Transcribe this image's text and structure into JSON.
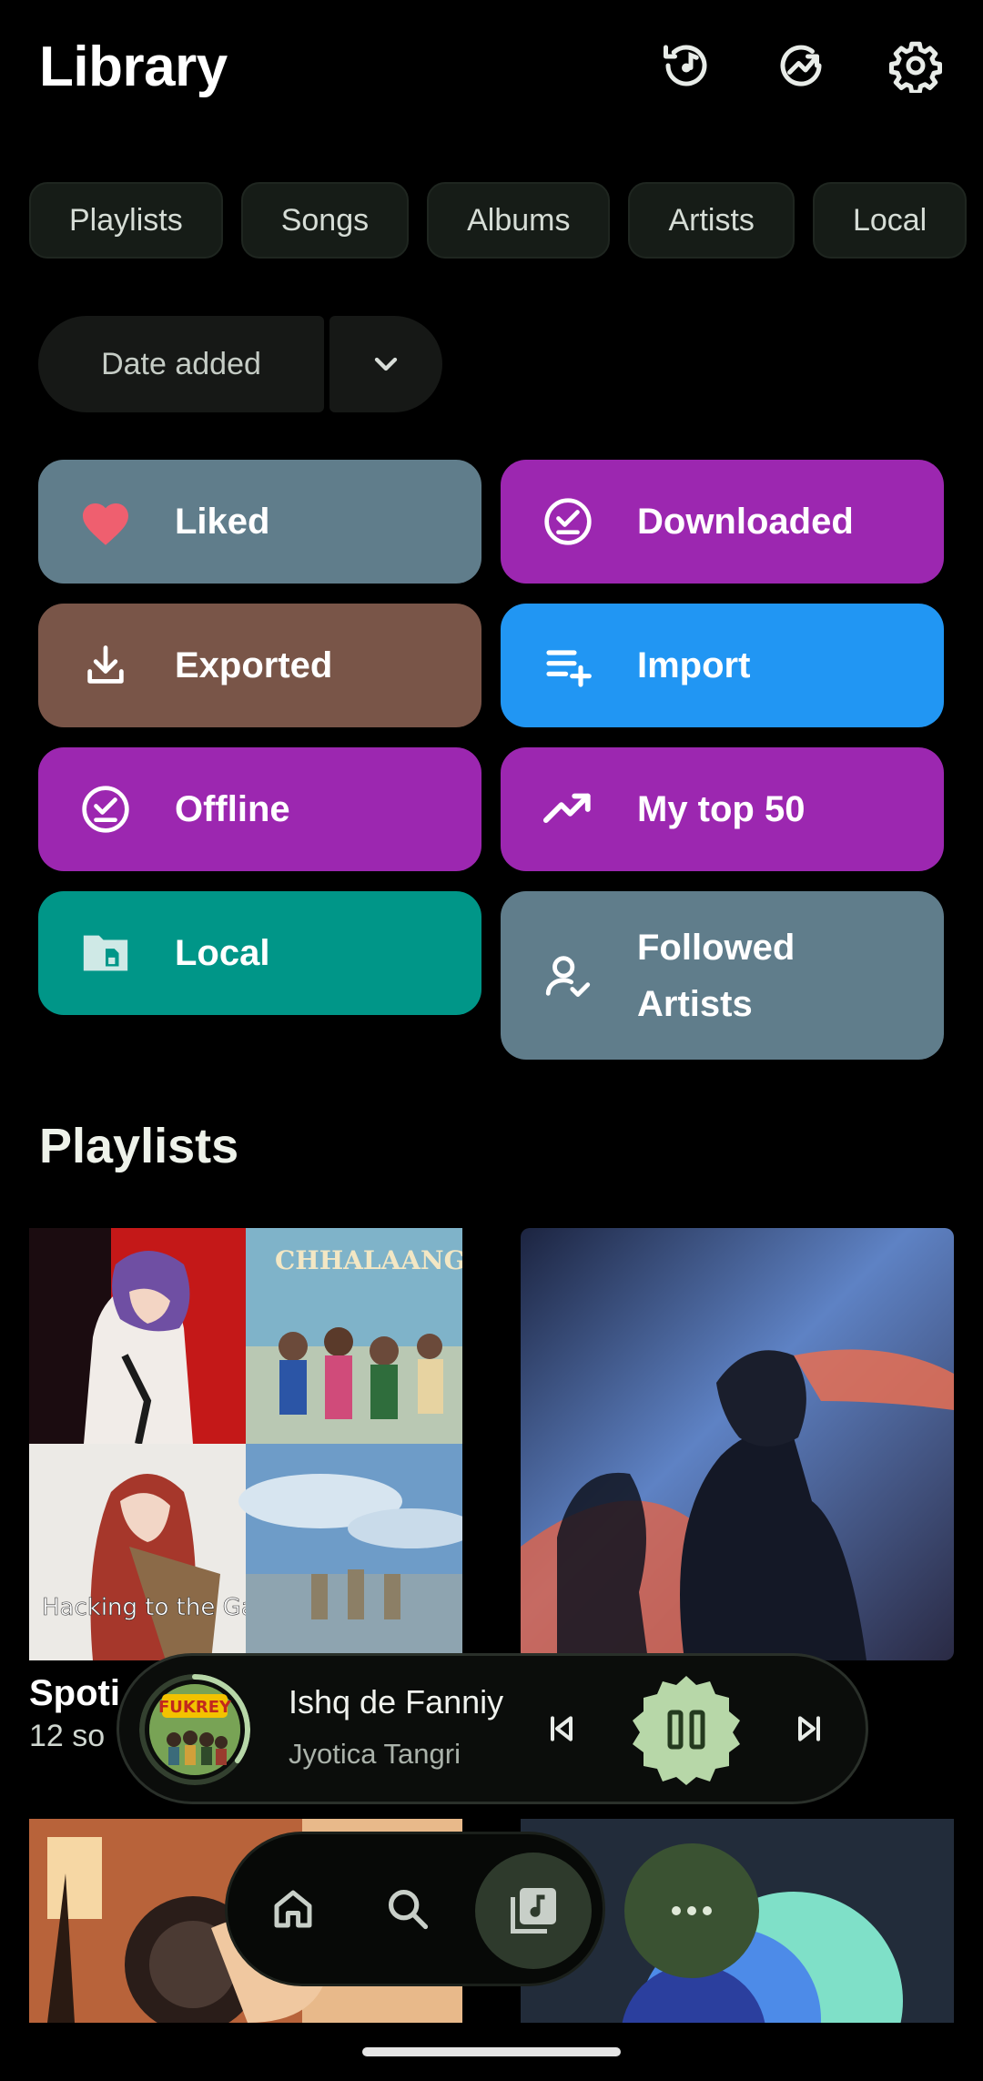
{
  "header": {
    "title": "Library",
    "icons": [
      "history-icon",
      "stats-icon",
      "settings-icon"
    ]
  },
  "chips": [
    "Playlists",
    "Songs",
    "Albums",
    "Artists",
    "Local"
  ],
  "sort": {
    "label": "Date added"
  },
  "tiles": {
    "liked": {
      "label": "Liked",
      "color": "#607d8b",
      "icon": "heart-icon"
    },
    "downloaded": {
      "label": "Downloaded",
      "color": "#9c27b0",
      "icon": "download-done-icon"
    },
    "exported": {
      "label": "Exported",
      "color": "#795548",
      "icon": "export-icon"
    },
    "import": {
      "label": "Import",
      "color": "#2196f3",
      "icon": "playlist-add-icon"
    },
    "offline": {
      "label": "Offline",
      "color": "#9c27b0",
      "icon": "offline-check-icon"
    },
    "top50": {
      "label": "My top 50",
      "color": "#9c27b0",
      "icon": "trending-up-icon"
    },
    "local": {
      "label": "Local",
      "color": "#009688",
      "icon": "folder-icon"
    },
    "followed": {
      "label": "Followed Artists",
      "color": "#607d8b",
      "icon": "person-check-icon"
    }
  },
  "section": {
    "playlists_title": "Playlists"
  },
  "playlists": [
    {
      "name": "Spoti",
      "count": "12 so"
    }
  ],
  "mini_player": {
    "title": "Ishq de Fanniy",
    "artist": "Jyotica Tangri",
    "progress": 0.35
  },
  "nav": {
    "items": [
      "home-icon",
      "search-icon",
      "library-icon"
    ],
    "active": "library"
  }
}
